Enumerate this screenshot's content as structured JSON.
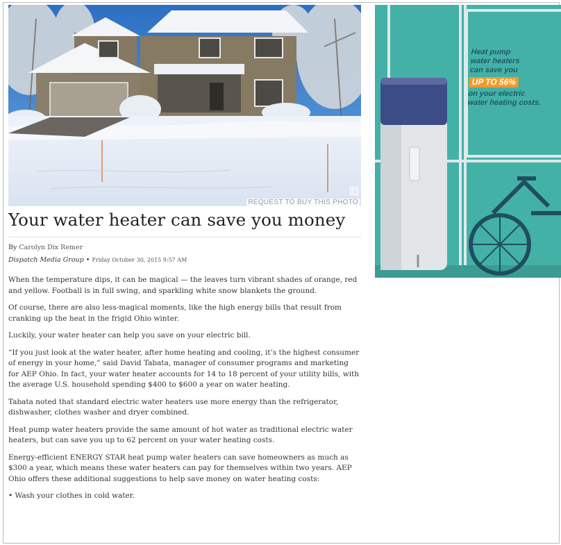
{
  "photo": {
    "credit": "REQUEST TO BUY THIS PHOTO",
    "enlarge_icon": "expand-icon"
  },
  "ad": {
    "line1": "Heat pump",
    "line2": "water heaters",
    "line3": "can save you",
    "highlight": "UP TO 56%",
    "line4": "on your electric",
    "line5": "water heating costs."
  },
  "article": {
    "headline": "Your water heater can save you money",
    "by_prefix": "By",
    "author": "Carolyn Dix Remer",
    "organization": "Dispatch Media Group",
    "separator": "•",
    "date": "Friday October 30, 2015 9:57 AM",
    "paragraphs": [
      "When the temperature dips, it can be magical — the leaves turn vibrant shades of orange, red and yellow. Football is in full swing, and sparkling white snow blankets the ground.",
      "Of course, there are also less-magical moments, like the high energy bills that result from cranking up the heat in the frigid Ohio winter.",
      "Luckily, your water heater can help you save on your electric bill.",
      "“If you just look at the water heater, after home heating and cooling, it’s the highest consumer of energy in your home,” said David Tabata, manager of consumer programs and marketing for AEP Ohio. In fact, your water heater accounts for 14 to 18 percent of your utility bills, with the average U.S. household spending $400 to $600 a year on water heating.",
      "Tabata noted that standard electric water heaters use more energy than the refrigerator, dishwasher, clothes washer and dryer combined.",
      "Heat pump water heaters provide the same amount of hot water as traditional electric water heaters, but can save you up to 62 percent on your water heating costs.",
      "Energy-efficient ENERGY STAR heat pump water heaters can save homeowners as much as $300 a year, which means these water heaters can pay for themselves within two years. AEP Ohio offers these additional suggestions to help save money on water heating costs:",
      "• Wash your clothes in cold water."
    ]
  }
}
